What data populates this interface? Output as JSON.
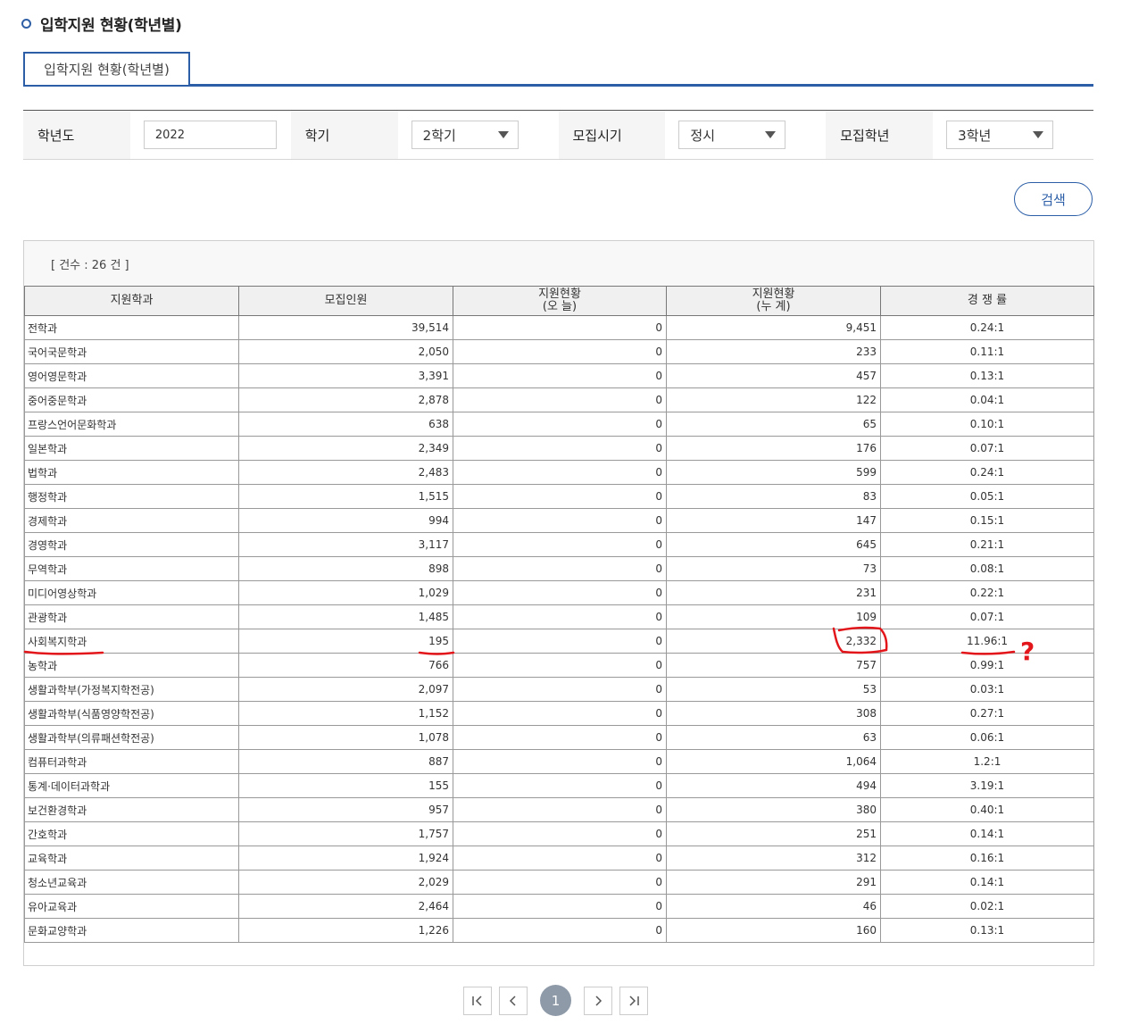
{
  "header": {
    "title": "입학지원 현황(학년별)"
  },
  "tab": {
    "label": "입학지원 현황(학년별)"
  },
  "filters": {
    "year_label": "학년도",
    "year_value": "2022",
    "semester_label": "학기",
    "semester_value": "2학기",
    "period_label": "모집시기",
    "period_value": "정시",
    "grade_label": "모집학년",
    "grade_value": "3학년"
  },
  "search_button": "검색",
  "count_text": "[ 건수 : 26 건 ]",
  "table": {
    "headers": [
      "지원학과",
      "모집인원",
      "지원현황\n(오    늘)",
      "지원현황\n(누    계)",
      "경 쟁 률"
    ],
    "rows": [
      [
        "전학과",
        "39,514",
        "0",
        "9,451",
        "0.24:1"
      ],
      [
        "국어국문학과",
        "2,050",
        "0",
        "233",
        "0.11:1"
      ],
      [
        "영어영문학과",
        "3,391",
        "0",
        "457",
        "0.13:1"
      ],
      [
        "중어중문학과",
        "2,878",
        "0",
        "122",
        "0.04:1"
      ],
      [
        "프랑스언어문화학과",
        "638",
        "0",
        "65",
        "0.10:1"
      ],
      [
        "일본학과",
        "2,349",
        "0",
        "176",
        "0.07:1"
      ],
      [
        "법학과",
        "2,483",
        "0",
        "599",
        "0.24:1"
      ],
      [
        "행정학과",
        "1,515",
        "0",
        "83",
        "0.05:1"
      ],
      [
        "경제학과",
        "994",
        "0",
        "147",
        "0.15:1"
      ],
      [
        "경영학과",
        "3,117",
        "0",
        "645",
        "0.21:1"
      ],
      [
        "무역학과",
        "898",
        "0",
        "73",
        "0.08:1"
      ],
      [
        "미디어영상학과",
        "1,029",
        "0",
        "231",
        "0.22:1"
      ],
      [
        "관광학과",
        "1,485",
        "0",
        "109",
        "0.07:1"
      ],
      [
        "사회복지학과",
        "195",
        "0",
        "2,332",
        "11.96:1"
      ],
      [
        "농학과",
        "766",
        "0",
        "757",
        "0.99:1"
      ],
      [
        "생활과학부(가정복지학전공)",
        "2,097",
        "0",
        "53",
        "0.03:1"
      ],
      [
        "생활과학부(식품영양학전공)",
        "1,152",
        "0",
        "308",
        "0.27:1"
      ],
      [
        "생활과학부(의류패션학전공)",
        "1,078",
        "0",
        "63",
        "0.06:1"
      ],
      [
        "컴퓨터과학과",
        "887",
        "0",
        "1,064",
        "1.2:1"
      ],
      [
        "통계·데이터과학과",
        "155",
        "0",
        "494",
        "3.19:1"
      ],
      [
        "보건환경학과",
        "957",
        "0",
        "380",
        "0.40:1"
      ],
      [
        "간호학과",
        "1,757",
        "0",
        "251",
        "0.14:1"
      ],
      [
        "교육학과",
        "1,924",
        "0",
        "312",
        "0.16:1"
      ],
      [
        "청소년교육과",
        "2,029",
        "0",
        "291",
        "0.14:1"
      ],
      [
        "유아교육과",
        "2,464",
        "0",
        "46",
        "0.02:1"
      ],
      [
        "문화교양학과",
        "1,226",
        "0",
        "160",
        "0.13:1"
      ]
    ]
  },
  "pagination": {
    "current": "1"
  },
  "annotation": {
    "mark": "?",
    "color": "#e3171b"
  },
  "colors": {
    "accent": "#2b5ea7",
    "page_current": "#8e9aa8"
  }
}
